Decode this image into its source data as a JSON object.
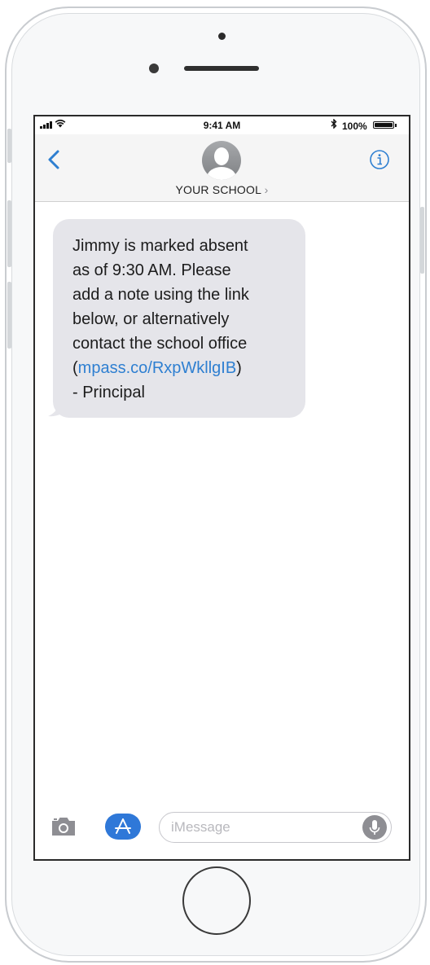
{
  "status_bar": {
    "time": "9:41 AM",
    "battery_percent": "100%",
    "signal_icon": "signal-bars-icon",
    "wifi_icon": "wifi-icon",
    "bluetooth_icon": "bluetooth-icon",
    "battery_icon": "battery-icon",
    "battery_level": 1.0
  },
  "header": {
    "contact_name": "YOUR SCHOOL",
    "back_icon": "chevron-left-icon",
    "info_icon": "info-icon",
    "avatar_icon": "person-silhouette-icon"
  },
  "message": {
    "lines": [
      "Jimmy is marked absent",
      "as of 9:30 AM. Please",
      "add a note using the link",
      "below, or alternatively",
      "contact the school office"
    ],
    "link_open": "(",
    "link_text": "mpass.co/RxpWkllgIB",
    "link_close": ")",
    "signature": "- Principal"
  },
  "composer": {
    "placeholder": "iMessage",
    "camera_icon": "camera-icon",
    "apps_icon": "app-store-icon",
    "mic_icon": "microphone-icon"
  },
  "colors": {
    "bubble": "#e5e5ea",
    "link": "#2e7fd1",
    "accent": "#2f78d8"
  }
}
